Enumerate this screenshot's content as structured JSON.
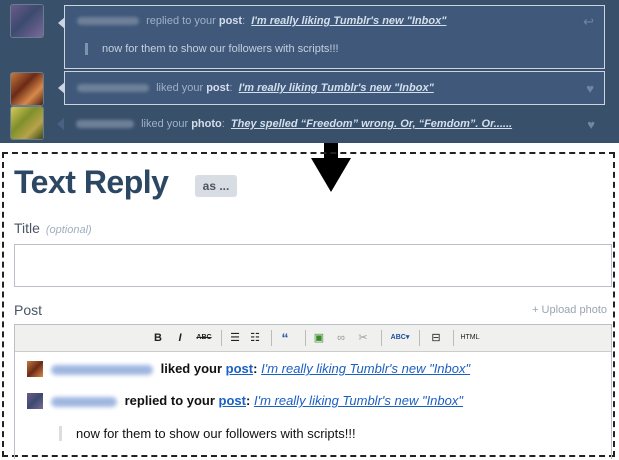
{
  "dashboard": {
    "notifications": [
      {
        "action": "replied to your",
        "object": "post",
        "title": "I'm really liking Tumblr's new \"Inbox\"",
        "quote": "now for them to show our followers with scripts!!!",
        "icon": "reply-icon"
      },
      {
        "action": "liked your",
        "object": "post",
        "title": "I'm really liking Tumblr's new \"Inbox\"",
        "icon": "heart-icon"
      },
      {
        "action": "liked your",
        "object": "photo",
        "title": "They spelled “Freedom” wrong. Or, “Femdom”. Or......",
        "icon": "heart-icon"
      }
    ]
  },
  "reply": {
    "heading": "Text Reply",
    "as_label": "as ...",
    "title_label": "Title",
    "title_optional": "(optional)",
    "title_value": "",
    "post_label": "Post",
    "upload_label": "+ Upload photo",
    "toolbar": {
      "bold": "B",
      "italic": "I",
      "strike": "ABC",
      "spell": "ABC",
      "html": "HTML"
    },
    "content": {
      "line1": {
        "action": "liked your",
        "object": "post",
        "colon": ":",
        "title": "I'm really liking Tumblr's new \"Inbox\""
      },
      "line2": {
        "action": "replied to your",
        "object": "post",
        "colon": ":",
        "title": "I'm really liking Tumblr's new \"Inbox\""
      },
      "quote": "now for them to show our followers with scripts!!!"
    }
  },
  "colors": {
    "dashboard_bg": "#39506b",
    "heading": "#2c4762",
    "link": "#1a5fc4"
  }
}
